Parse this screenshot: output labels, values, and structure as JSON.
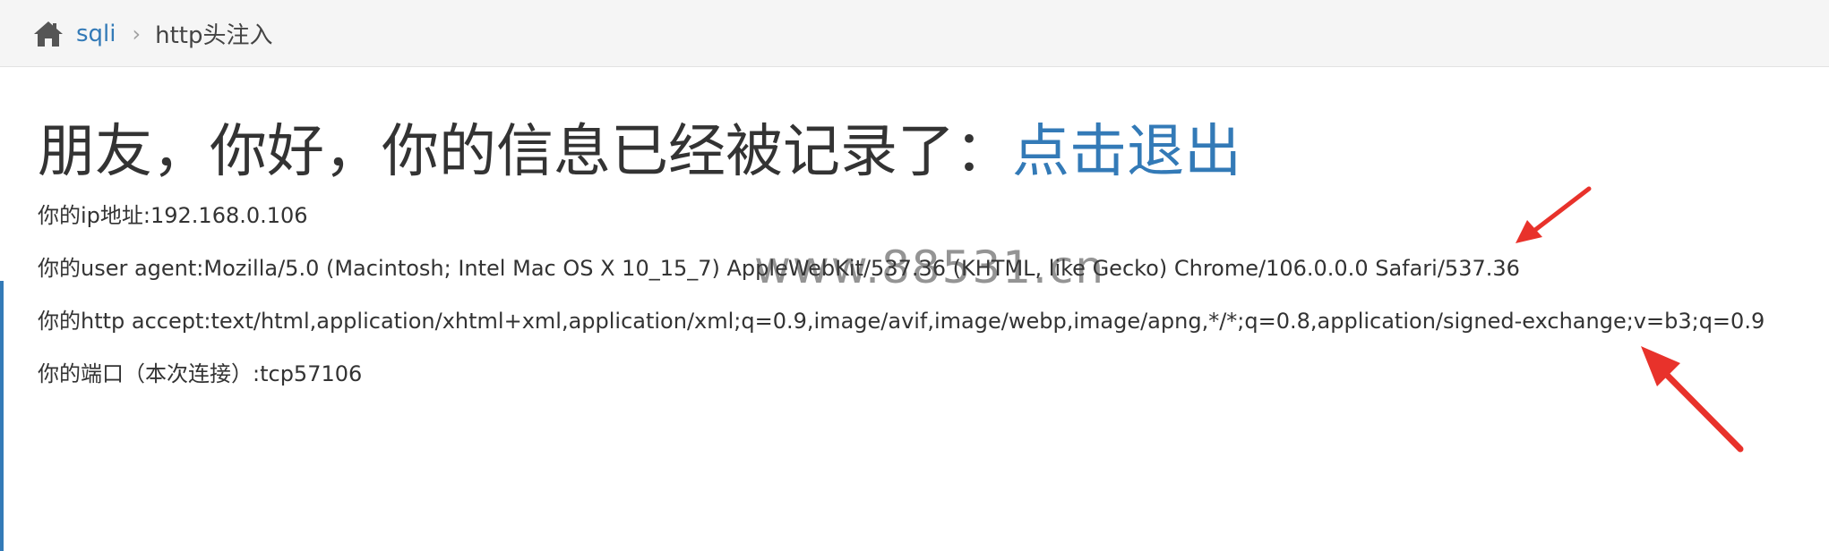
{
  "breadcrumb": {
    "home_icon": "home-icon",
    "link": "sqli",
    "separator": "›",
    "current": "http头注入"
  },
  "main": {
    "heading_prefix": "朋友，你好，你的信息已经被记录了：",
    "logout_link": "点击退出",
    "ip_line": "你的ip地址:192.168.0.106",
    "user_agent_line": "你的user agent:Mozilla/5.0 (Macintosh; Intel Mac OS X 10_15_7) AppleWebKit/537.36 (KHTML, like Gecko) Chrome/106.0.0.0 Safari/537.36",
    "accept_line": "你的http accept:text/html,application/xhtml+xml,application/xml;q=0.9,image/avif,image/webp,image/apng,*/*;q=0.8,application/signed-exchange;v=b3;q=0.9",
    "port_line": "你的端口（本次连接）:tcp57106"
  },
  "overlay": {
    "watermark": "www.88531.cn",
    "arrow_color": "#e8322b",
    "link_color": "#337ab7"
  }
}
